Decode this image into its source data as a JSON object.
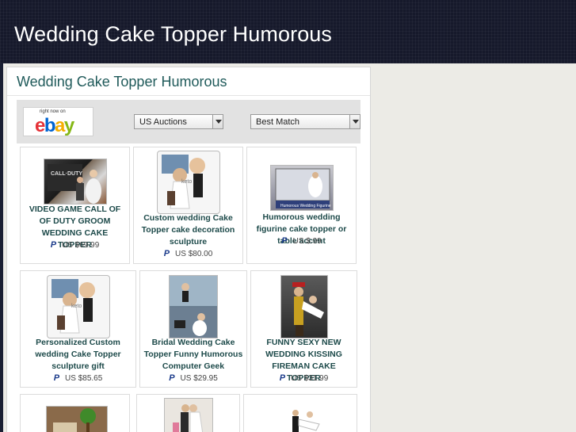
{
  "site": {
    "title": "Wedding Cake Topper Humorous"
  },
  "panel": {
    "title": "Wedding Cake Topper Humorous"
  },
  "toolbar": {
    "ebay_caption": "right now on",
    "ebay_logo": {
      "e": "e",
      "b": "b",
      "a": "a",
      "y": "y"
    },
    "auction_select": "US Auctions",
    "sort_select": "Best Match"
  },
  "listings": [
    {
      "title": "VIDEO GAME CALL OF OF DUTY GROOM WEDDING CAKE TOPPER",
      "price": "US $69.99",
      "payment_icon": "paypal-icon",
      "image": "call-of-duty-topper"
    },
    {
      "title": "Custom wedding Cake Topper cake decoration sculpture",
      "price": "US $80.00",
      "payment_icon": "paypal-icon",
      "image": "bobblehead-couple"
    },
    {
      "title": "Humorous wedding figurine cake topper or table accent",
      "price": "US $.99",
      "payment_icon": "paypal-icon",
      "image": "figurine-box"
    },
    {
      "title": "Personalized Custom wedding Cake Topper sculpture gift",
      "price": "US $85.65",
      "payment_icon": "paypal-icon",
      "image": "bobblehead-couple"
    },
    {
      "title": "Bridal Wedding Cake Topper Funny Humorous Computer Geek",
      "price": "US $29.95",
      "payment_icon": "paypal-icon",
      "image": "computer-geek-topper"
    },
    {
      "title": "FUNNY SEXY NEW WEDDING KISSING FIREMAN CAKE TOPPER",
      "price": "US $31.99",
      "payment_icon": "paypal-icon",
      "image": "fireman-topper"
    },
    {
      "title": "",
      "price": "",
      "payment_icon": "",
      "image": "tree-topper"
    },
    {
      "title": "",
      "price": "",
      "payment_icon": "",
      "image": "kissing-couple"
    },
    {
      "title": "",
      "price": "",
      "payment_icon": "",
      "image": "dancing-couple"
    }
  ]
}
